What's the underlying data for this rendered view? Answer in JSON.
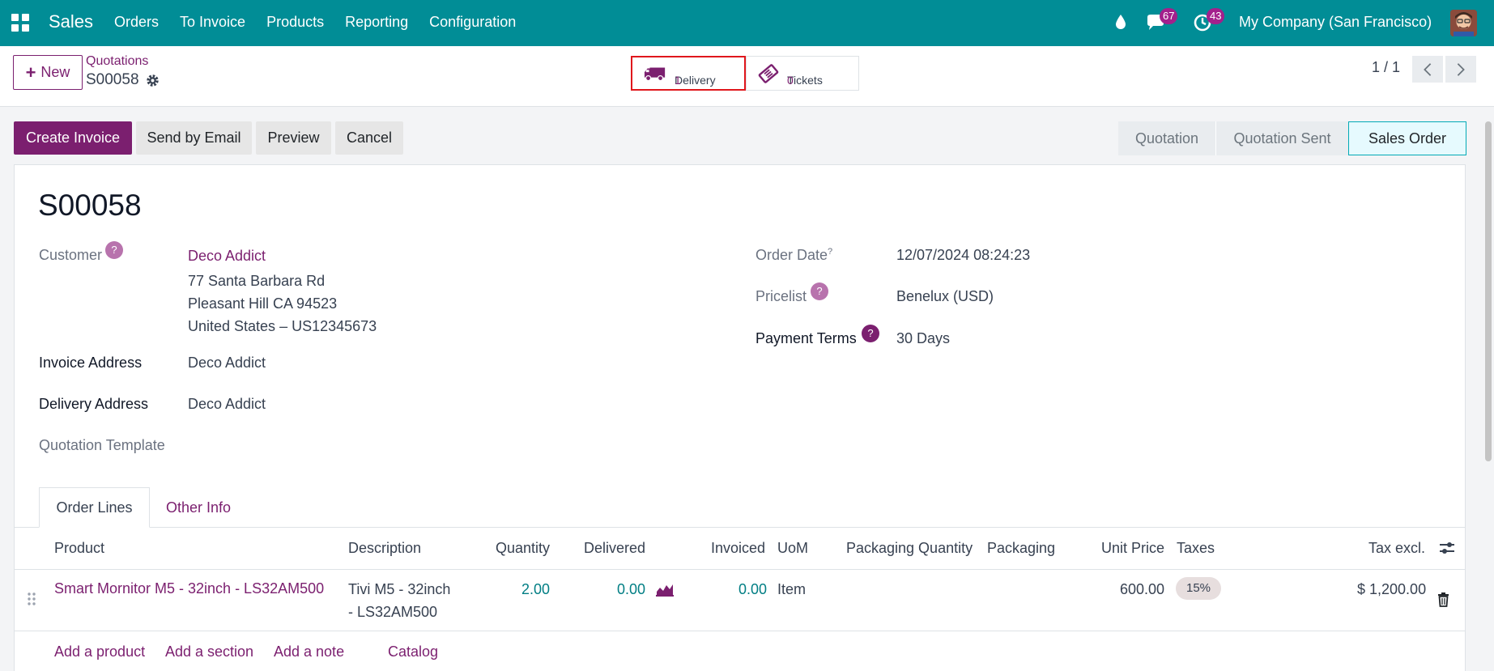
{
  "navbar": {
    "app_name": "Sales",
    "menu": [
      "Orders",
      "To Invoice",
      "Products",
      "Reporting",
      "Configuration"
    ],
    "messages_count": "67",
    "activities_count": "43",
    "company": "My Company (San Francisco)"
  },
  "control_panel": {
    "new_label": "New",
    "breadcrumb": "Quotations",
    "record_name": "S00058",
    "smart_buttons": [
      {
        "label": "Delivery",
        "value": "1"
      },
      {
        "label": "Tickets",
        "value": "0"
      }
    ],
    "pager": "1 / 1"
  },
  "actions": {
    "create_invoice": "Create Invoice",
    "send_email": "Send by Email",
    "preview": "Preview",
    "cancel": "Cancel"
  },
  "statusbar": [
    "Quotation",
    "Quotation Sent",
    "Sales Order"
  ],
  "form": {
    "title": "S00058",
    "customer_label": "Customer",
    "customer_name": "Deco Addict",
    "customer_address": [
      "77 Santa Barbara Rd",
      "Pleasant Hill CA 94523",
      "United States – US12345673"
    ],
    "invoice_address_label": "Invoice Address",
    "invoice_address": "Deco Addict",
    "delivery_address_label": "Delivery Address",
    "delivery_address": "Deco Addict",
    "quotation_template_label": "Quotation Template",
    "order_date_label": "Order Date",
    "order_date": "12/07/2024 08:24:23",
    "pricelist_label": "Pricelist",
    "pricelist": "Benelux (USD)",
    "payment_terms_label": "Payment Terms",
    "payment_terms": "30 Days",
    "help_mark": "?"
  },
  "tabs": [
    "Order Lines",
    "Other Info"
  ],
  "table": {
    "headers": [
      "Product",
      "Description",
      "Quantity",
      "Delivered",
      "Invoiced",
      "UoM",
      "Packaging Quantity",
      "Packaging",
      "Unit Price",
      "Taxes",
      "Tax excl."
    ],
    "row": {
      "product": "Smart Mornitor M5 - 32inch - LS32AM500",
      "description_1": "Tivi M5 - 32inch",
      "description_2": "- LS32AM500",
      "quantity": "2.00",
      "delivered": "0.00",
      "invoiced": "0.00",
      "uom": "Item",
      "unit_price": "600.00",
      "taxes": "15%",
      "tax_excl": "$ 1,200.00"
    },
    "add_links": [
      "Add a product",
      "Add a section",
      "Add a note",
      "Catalog"
    ]
  }
}
